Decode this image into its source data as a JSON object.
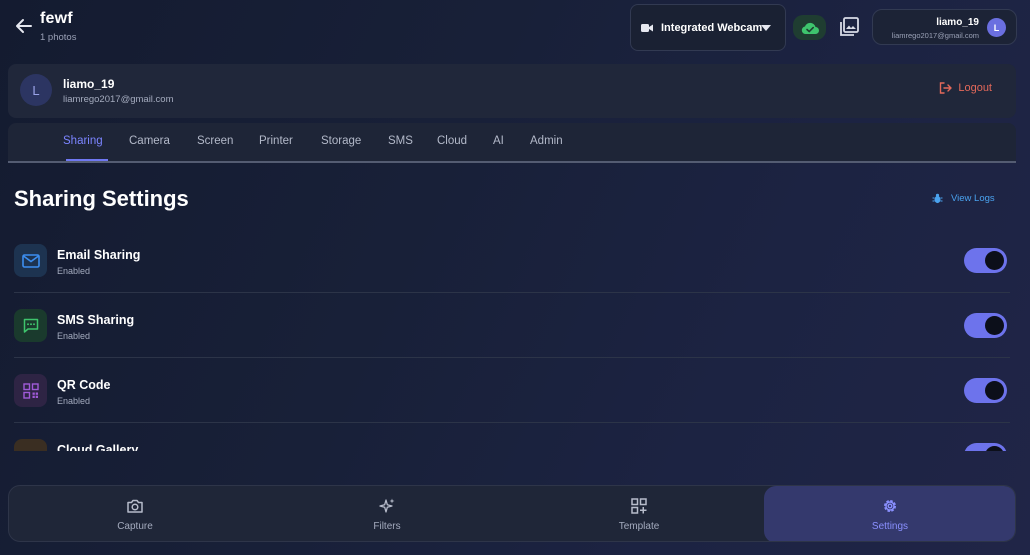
{
  "header": {
    "album_title": "fewf",
    "album_count": "1 photos",
    "camera": {
      "label": "Integrated Webcam",
      "icon": "video-camera-icon"
    },
    "cloud_status_color": "#3ec46d",
    "user": {
      "name": "liamo_19",
      "email": "liamrego2017@gmail.com",
      "initial": "L"
    }
  },
  "account": {
    "initial": "L",
    "name": "liamo_19",
    "email": "liamrego2017@gmail.com",
    "logout_label": "Logout"
  },
  "tabs": [
    {
      "label": "Sharing",
      "active": true
    },
    {
      "label": "Camera"
    },
    {
      "label": "Screen"
    },
    {
      "label": "Printer"
    },
    {
      "label": "Storage"
    },
    {
      "label": "SMS"
    },
    {
      "label": "Cloud"
    },
    {
      "label": "AI"
    },
    {
      "label": "Admin"
    }
  ],
  "settings": {
    "title": "Sharing Settings",
    "view_logs_label": "View Logs",
    "items": [
      {
        "title": "Email Sharing",
        "status": "Enabled",
        "icon": "mail-icon",
        "enabled": true
      },
      {
        "title": "SMS Sharing",
        "status": "Enabled",
        "icon": "message-icon",
        "enabled": true
      },
      {
        "title": "QR Code",
        "status": "Enabled",
        "icon": "qr-code-icon",
        "enabled": true
      },
      {
        "title": "Cloud Gallery",
        "status": "",
        "icon": "cloud-icon",
        "enabled": true
      }
    ]
  },
  "bottom_nav": [
    {
      "label": "Capture",
      "icon": "camera-icon"
    },
    {
      "label": "Filters",
      "icon": "sparkles-icon"
    },
    {
      "label": "Template",
      "icon": "grid-plus-icon"
    },
    {
      "label": "Settings",
      "icon": "gear-icon",
      "active": true
    }
  ],
  "colors": {
    "accent": "#6d73ec",
    "active_tab": "#7b84ff",
    "logout": "#e4695a",
    "link": "#4aa2ee"
  }
}
